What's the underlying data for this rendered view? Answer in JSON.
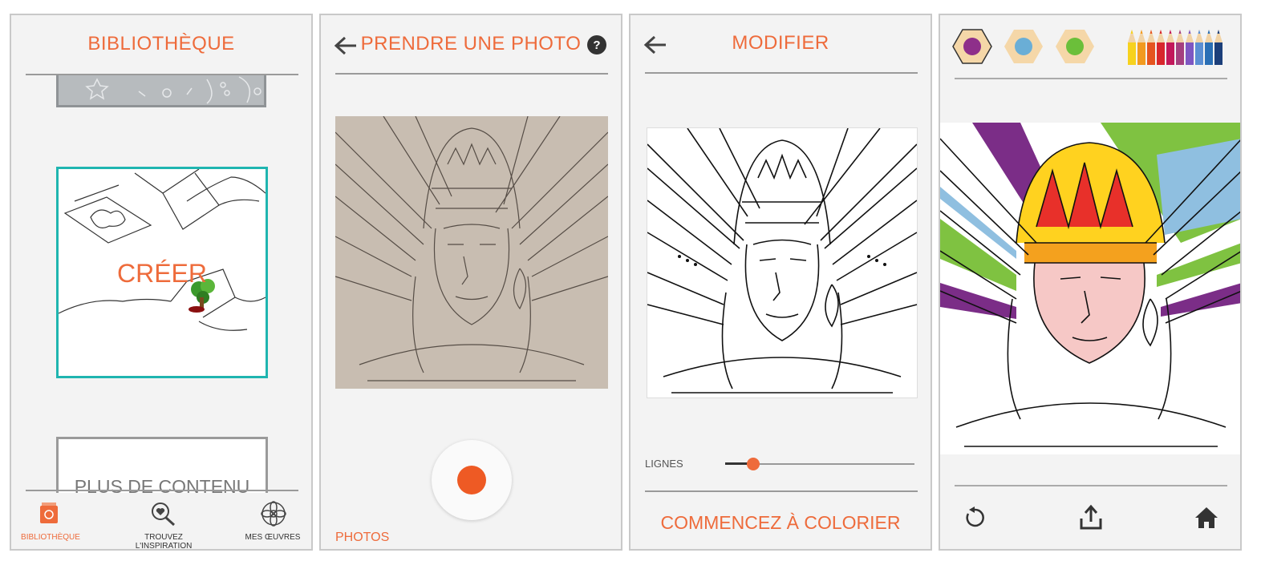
{
  "screen1": {
    "title": "BIBLIOTHÈQUE",
    "create_label": "CRÉER",
    "more_label": "PLUS DE CONTENU",
    "tabs": [
      {
        "label": "BIBLIOTHÈQUE",
        "icon": "library-icon",
        "active": true
      },
      {
        "label": "TROUVEZ L'INSPIRATION",
        "icon": "search-heart-icon",
        "active": false
      },
      {
        "label": "MES ŒUVRES",
        "icon": "flower-icon",
        "active": false
      }
    ]
  },
  "screen2": {
    "title": "PRENDRE UNE PHOTO",
    "photos_label": "PHOTOS",
    "help_icon": "help-icon",
    "back_icon": "arrow-left-icon"
  },
  "screen3": {
    "title": "MODIFIER",
    "slider_label": "LIGNES",
    "slider_value": 0.15,
    "cta_label": "COMMENCEZ À COLORIER",
    "back_icon": "arrow-left-icon"
  },
  "screen4": {
    "palette": [
      "#8e2f8a",
      "#6aaed6",
      "#6bbf3a"
    ],
    "pencil_colors": [
      "#f7d21e",
      "#f29a1f",
      "#e5541f",
      "#d8262c",
      "#c2185b",
      "#a4407f",
      "#7e57c2",
      "#5b8fd3",
      "#2a6fb5",
      "#1c3f7a"
    ],
    "toolbar": [
      "undo-icon",
      "share-icon",
      "home-icon"
    ]
  },
  "colors": {
    "accent": "#ee6b3b",
    "teal": "#1fb5b0"
  }
}
